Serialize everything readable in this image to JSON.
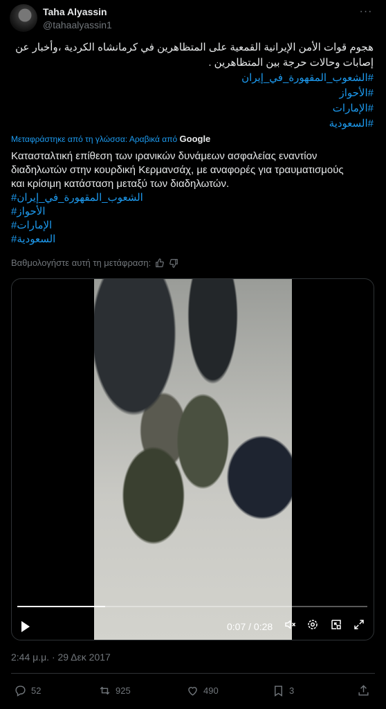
{
  "author": {
    "name": "Taha Alyassin",
    "handle": "@tahaalyassin1"
  },
  "post": {
    "original_line1": "هجوم قوات الأمن الإيرانية القمعية على المتظاهرين في كرمانشاه الكردية ،وأخبار عن",
    "original_line2": "إصابات وحالات حرجة بين المتظاهرين .",
    "original_tags": [
      "#الشعوب_المقهورة_في_إيران",
      "#الأحواز",
      "#الإمارات",
      "#السعودية"
    ],
    "translated_from": "Μεταφράστηκε από τη γλώσσα: Αραβικά από",
    "translator": "Google",
    "translation_line1": "Κατασταλτική επίθεση των ιρανικών δυνάμεων ασφαλείας εναντίον",
    "translation_line2": "διαδηλωτών στην κουρδική Κερμανσάχ, με αναφορές για τραυματισμούς",
    "translation_line3": "και κρίσιμη κατάσταση μεταξύ των διαδηλωτών.",
    "translation_tags": [
      "#الشعوب_المقهورة_في_إيران",
      "#الأحواز",
      "#الإمارات",
      "#السعودية"
    ],
    "rate_translation": "Βαθμολογήστε αυτή τη μετάφραση:"
  },
  "video": {
    "current_time": "0:07",
    "duration": "0:28",
    "time_display": "0:07 / 0:28",
    "progress_fraction": 0.25
  },
  "timestamp": "2:44 μ.μ. · 29 Δεκ 2017",
  "actions": {
    "replies": "52",
    "reposts": "925",
    "likes": "490",
    "bookmarks": "3"
  },
  "colors": {
    "background": "#000000",
    "text": "#e7e9ea",
    "muted": "#71767b",
    "link": "#1d9bf0",
    "border": "#2f3336"
  }
}
